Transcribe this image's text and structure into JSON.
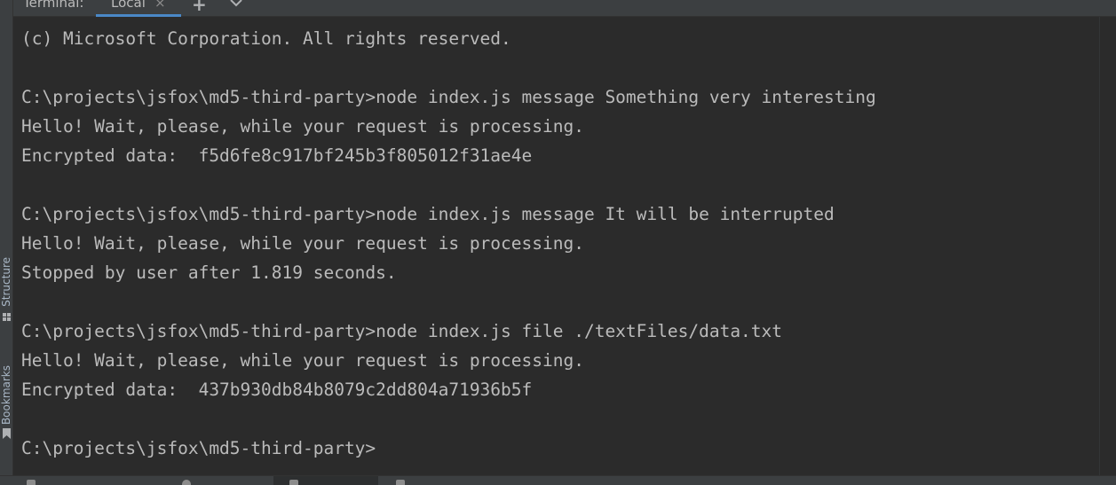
{
  "toolwindow": {
    "title": "Terminal:",
    "tabs": [
      {
        "label": "Local",
        "close_glyph": "×",
        "active": true
      }
    ],
    "add_tab_glyph": "+",
    "more_icon": "chevron-down-icon"
  },
  "left_stripe": {
    "items": [
      {
        "label": "Structure",
        "icon": "structure-icon"
      },
      {
        "label": "Bookmarks",
        "icon": "bookmark-icon"
      }
    ]
  },
  "terminal": {
    "lines": [
      "(c) Microsoft Corporation. All rights reserved.",
      "",
      "C:\\projects\\jsfox\\md5-third-party>node index.js message Something very interesting",
      "Hello! Wait, please, while your request is processing.",
      "Encrypted data:  f5d6fe8c917bf245b3f805012f31ae4e",
      "",
      "C:\\projects\\jsfox\\md5-third-party>node index.js message It will be interrupted",
      "Hello! Wait, please, while your request is processing.",
      "Stopped by user after 1.819 seconds.",
      "",
      "C:\\projects\\jsfox\\md5-third-party>node index.js file ./textFiles/data.txt",
      "Hello! Wait, please, while your request is processing.",
      "Encrypted data:  437b930db84b8079c2dd804a71936b5f",
      "",
      "C:\\projects\\jsfox\\md5-third-party>"
    ]
  },
  "colors": {
    "background": "#2b2b2b",
    "text": "#bbbbbb",
    "accent": "#4a88c7",
    "chrome": "#3c3f41"
  }
}
